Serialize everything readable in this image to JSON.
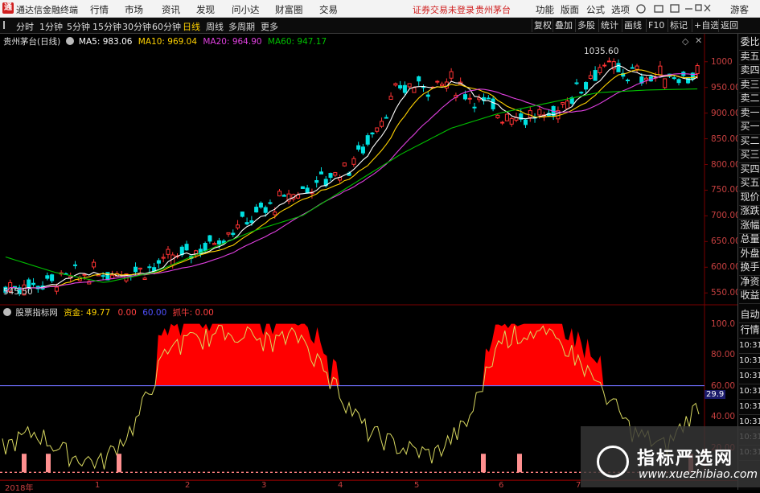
{
  "app": {
    "name": "通达信金融终端",
    "logo_glyph": "通"
  },
  "menu": [
    "行情",
    "市场",
    "资讯",
    "发现",
    "问小达",
    "财富圈",
    "交易"
  ],
  "notice": {
    "trade": "证券交易未登录",
    "stock": "贵州茅台"
  },
  "menu_right": [
    "功能",
    "版面",
    "公式",
    "选项"
  ],
  "menu_guest": "游客",
  "toolbar": {
    "timeframes": [
      "分时",
      "1分钟",
      "5分钟",
      "15分钟",
      "30分钟",
      "60分钟",
      "日线",
      "周线",
      "多周期",
      "更多"
    ],
    "active": "日线",
    "right_tools": [
      "复权",
      "叠加",
      "多股",
      "统计",
      "画线",
      "F10",
      "标记",
      "+自选",
      "返回"
    ]
  },
  "main_legend": {
    "title": "贵州茅台(日线)",
    "ma5": "MA5: 983.06",
    "ma10": "MA10: 969.04",
    "ma20": "MA20: 964.90",
    "ma60": "MA60: 947.17"
  },
  "price_annotations": {
    "high": "1035.60",
    "low": "545.50"
  },
  "sub_legend": {
    "title": "股票指标网",
    "zijin": "资金: 49.77",
    "v1": "0.00",
    "v2": "60.00",
    "zhuaniu": "抓牛: 0.00",
    "ref_value": "29.9"
  },
  "right_panel": [
    "委比",
    "卖五",
    "卖四",
    "卖三",
    "卖二",
    "卖一",
    "买一",
    "买二",
    "买三",
    "买四",
    "买五",
    "现价",
    "涨跌",
    "涨幅",
    "总量",
    "外盘",
    "换手",
    "净资",
    "收益"
  ],
  "right_panel2": [
    "自动",
    "行情",
    "10:31",
    "10:31",
    "10:31",
    "10:31",
    "10:31",
    "10:31",
    "10:31",
    "10:31"
  ],
  "x_axis": [
    "2018年",
    "1",
    "2",
    "3",
    "4",
    "5",
    "6",
    "7"
  ],
  "watermark": {
    "title": "指标严选网",
    "url": "www.xuezhibiao.com"
  },
  "colors": {
    "up": "#ff3333",
    "down": "#00e0e0",
    "ma5": "#ffffff",
    "ma10": "#ffd200",
    "ma20": "#e040e0",
    "ma60": "#00c000",
    "money_fill": "#ff0000",
    "money_line": "#d8d860"
  },
  "chart_data": [
    {
      "type": "line",
      "title": "贵州茅台(日线)",
      "y_ticks": [
        "1000",
        "950.00",
        "900.00",
        "850.00",
        "800.00",
        "750.00",
        "700.00",
        "650.00",
        "600.00",
        "550.00"
      ],
      "ylim": [
        530,
        1045
      ],
      "x": [
        "2018年",
        "1",
        "2",
        "3",
        "4",
        "5",
        "6",
        "7"
      ],
      "series": [
        {
          "name": "MA5",
          "values": [
            560,
            575,
            590,
            600,
            640,
            700,
            750,
            800,
            950,
            960,
            900,
            890,
            990,
            970,
            975
          ]
        },
        {
          "name": "MA60",
          "values": [
            620,
            590,
            570,
            590,
            630,
            670,
            700,
            760,
            820,
            870,
            900,
            920,
            940,
            945,
            947
          ]
        }
      ]
    },
    {
      "type": "area",
      "title": "股票指标网",
      "y_ticks": [
        "100.0",
        "80.00",
        "60.00",
        "40.00",
        "20.00"
      ],
      "ylim": [
        0,
        105
      ],
      "series": [
        {
          "name": "资金",
          "values": [
            20,
            30,
            15,
            10,
            35,
            85,
            90,
            95,
            88,
            92,
            60,
            30,
            20,
            15,
            35,
            90,
            95,
            85,
            60,
            30,
            20,
            48
          ]
        }
      ]
    }
  ]
}
